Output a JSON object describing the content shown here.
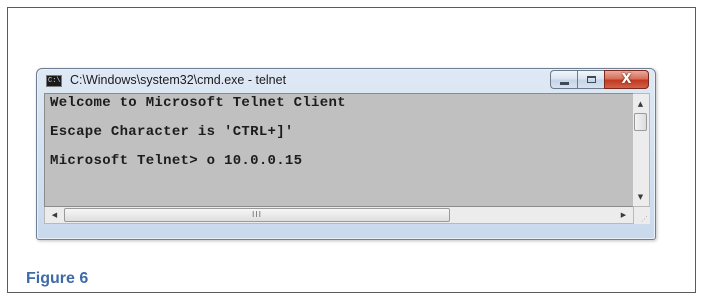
{
  "window": {
    "title": "C:\\Windows\\system32\\cmd.exe - telnet",
    "app_icon_text": "C:\\",
    "caption_buttons": {
      "minimize_icon": "minimize-icon",
      "maximize_icon": "maximize-icon",
      "close_label": "X"
    }
  },
  "console": {
    "background": "#c0c0c0",
    "text_color": "#1c1c1c",
    "lines": [
      "Welcome to Microsoft Telnet Client",
      "Escape Character is 'CTRL+]'",
      "Microsoft Telnet> o 10.0.0.15"
    ]
  },
  "scrollbars": {
    "up_arrow": "▲",
    "down_arrow": "▼",
    "left_arrow": "◀",
    "right_arrow": "▶",
    "thumb_grip": "III"
  },
  "caption": {
    "text": "Figure 6",
    "color": "#3f6aa8"
  }
}
